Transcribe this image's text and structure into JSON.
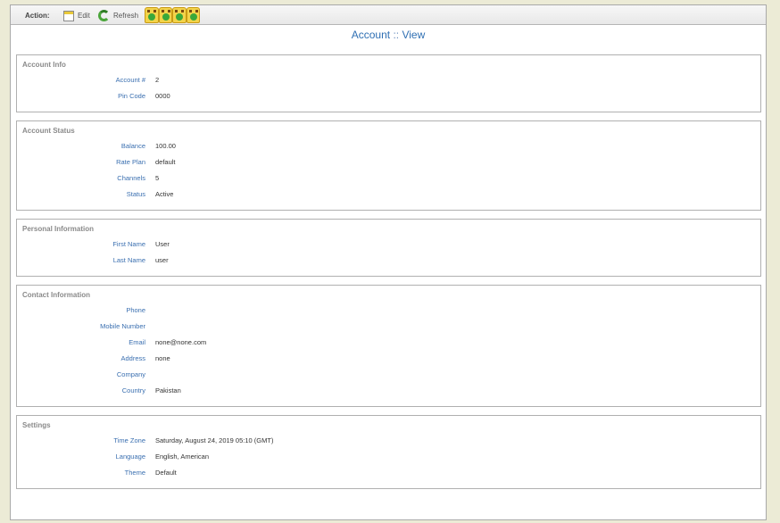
{
  "toolbar": {
    "action_label": "Action:",
    "edit_label": "Edit",
    "refresh_label": "Refresh"
  },
  "title": {
    "section": "Account",
    "separator": "::",
    "view": "View"
  },
  "account_info": {
    "legend": "Account Info",
    "rows": [
      {
        "label": "Account #",
        "value": "2"
      },
      {
        "label": "Pin Code",
        "value": "0000"
      }
    ]
  },
  "account_status": {
    "legend": "Account Status",
    "rows": [
      {
        "label": "Balance",
        "value": "100.00"
      },
      {
        "label": "Rate Plan",
        "value": "default"
      },
      {
        "label": "Channels",
        "value": "5"
      },
      {
        "label": "Status",
        "value": "Active"
      }
    ]
  },
  "personal_information": {
    "legend": "Personal Information",
    "rows": [
      {
        "label": "First Name",
        "value": "User"
      },
      {
        "label": "Last Name",
        "value": "user"
      }
    ]
  },
  "contact_information": {
    "legend": "Contact Information",
    "rows": [
      {
        "label": "Phone",
        "value": ""
      },
      {
        "label": "Mobile Number",
        "value": ""
      },
      {
        "label": "Email",
        "value": "none@none.com"
      },
      {
        "label": "Address",
        "value": "none"
      },
      {
        "label": "Company",
        "value": ""
      },
      {
        "label": "Country",
        "value": "Pakistan"
      }
    ]
  },
  "settings": {
    "legend": "Settings",
    "rows": [
      {
        "label": "Time Zone",
        "value": "Saturday, August 24, 2019 05:10 (GMT)"
      },
      {
        "label": "Language",
        "value": "English, American"
      },
      {
        "label": "Theme",
        "value": "Default"
      }
    ]
  },
  "colors": {
    "label_blue": "#3a6fb0",
    "title_blue": "#2f6fb3",
    "page_bg": "#ecebd6"
  }
}
